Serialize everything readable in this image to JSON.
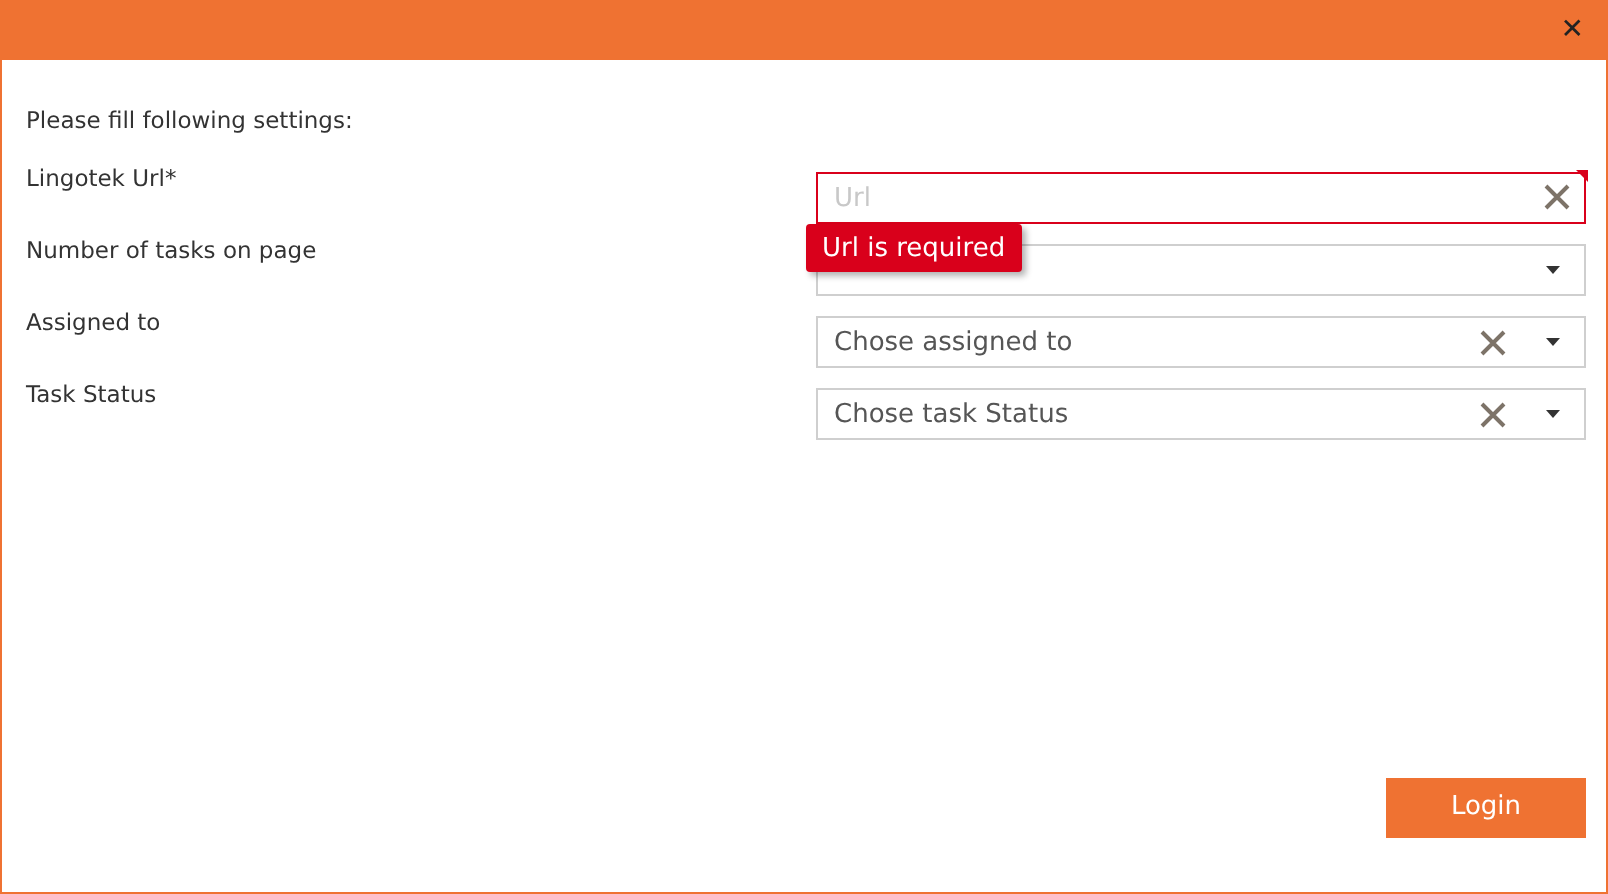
{
  "dialog": {
    "close": "✕",
    "intro": "Please fill following settings:"
  },
  "fields": [
    {
      "label": "Lingotek Url*",
      "kind": "text",
      "placeholder": "Url",
      "invalid": true,
      "clearable": true,
      "error": "Url is required"
    },
    {
      "label": "Number of tasks on page",
      "kind": "select",
      "clearable": false
    },
    {
      "label": "Assigned to",
      "kind": "select",
      "placeholder": "Chose assigned to",
      "clearable": true
    },
    {
      "label": "Task Status",
      "kind": "select",
      "placeholder": "Chose task Status",
      "clearable": true
    }
  ],
  "login_button": "Login"
}
